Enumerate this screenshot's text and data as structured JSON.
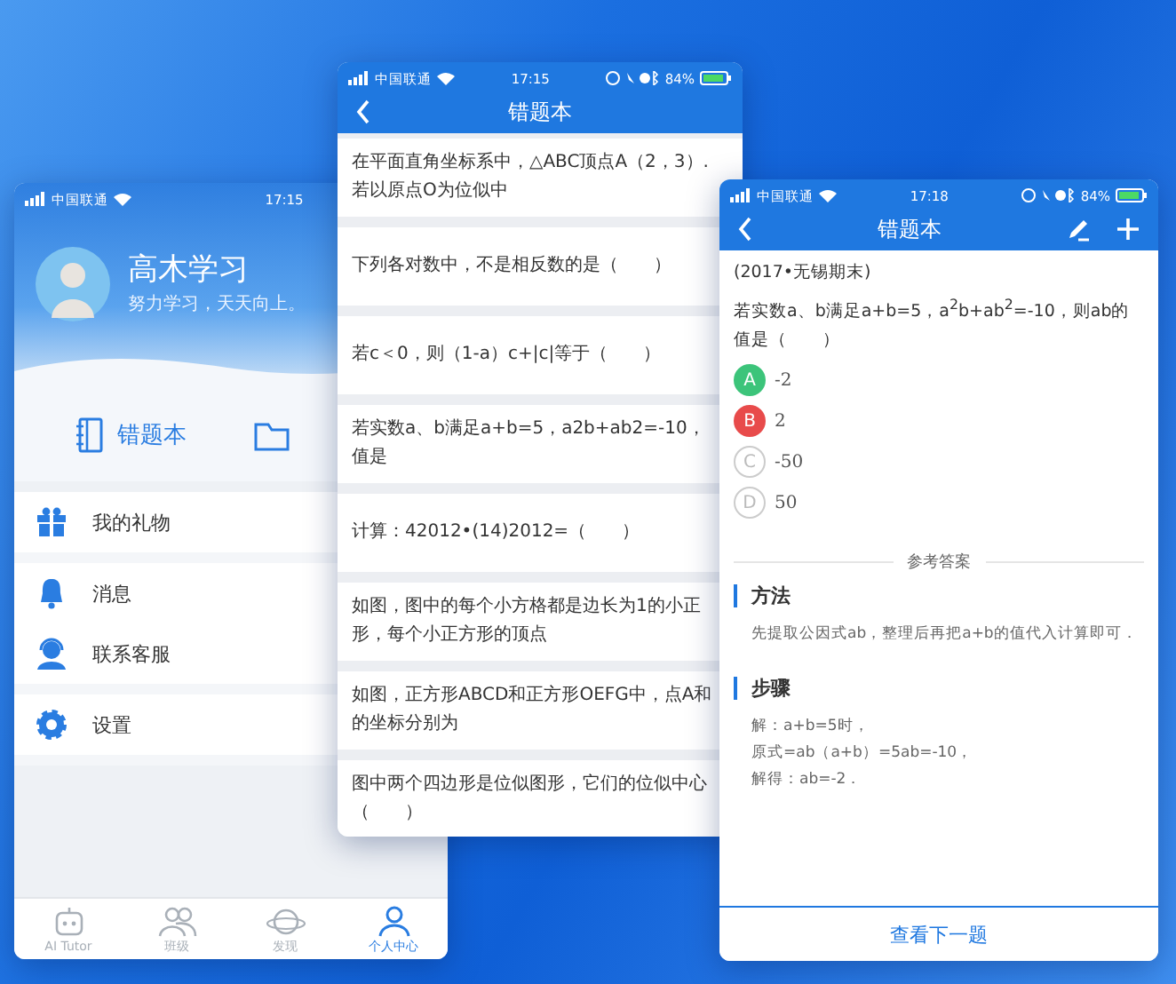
{
  "profile_screen": {
    "status_bar": {
      "carrier": "中国联通",
      "time": "17:15"
    },
    "name": "高木学习",
    "motto": "努力学习，天天向上。",
    "shortcuts": [
      {
        "label": "错题本"
      }
    ],
    "menu_groups": [
      [
        {
          "kind": "gift",
          "label": "我的礼物"
        }
      ],
      [
        {
          "kind": "bell",
          "label": "消息"
        },
        {
          "kind": "service",
          "label": "联系客服"
        }
      ],
      [
        {
          "kind": "gear",
          "label": "设置"
        }
      ]
    ],
    "tab_bar": [
      {
        "kind": "robot",
        "label": "AI Tutor",
        "selected": false
      },
      {
        "kind": "people",
        "label": "班级",
        "selected": false
      },
      {
        "kind": "planet",
        "label": "发现",
        "selected": false
      },
      {
        "kind": "person",
        "label": "个人中心",
        "selected": true
      }
    ]
  },
  "list_screen": {
    "status_bar": {
      "carrier": "中国联通",
      "time": "17:15",
      "battery": "84%"
    },
    "title": "错题本",
    "rows": [
      {
        "lines": [
          "在平面直角坐标系中，△ABC顶点A（2，3）.",
          "若以原点O为位似中"
        ]
      },
      {
        "lines": [
          "下列各对数中，不是相反数的是（　　）"
        ]
      },
      {
        "lines": [
          "若c＜0，则（1-a）c+|c|等于（　　）"
        ]
      },
      {
        "lines": [
          "若实数a、b满足a+b=5，a2b+ab2=-10，",
          "值是"
        ]
      },
      {
        "lines": [
          "计算：42012•(14)2012=（　　）"
        ]
      },
      {
        "lines": [
          "如图，图中的每个小方格都是边长为1的小正",
          "形，每个小正方形的顶点"
        ]
      },
      {
        "lines": [
          "如图，正方形ABCD和正方形OEFG中，点A和",
          "的坐标分别为"
        ]
      },
      {
        "lines": [
          "图中两个四边形是位似图形，它们的位似中心",
          "（　　）"
        ]
      }
    ]
  },
  "detail_screen": {
    "status_bar": {
      "carrier": "中国联通",
      "time": "17:18",
      "battery": "84%"
    },
    "title": "错题本",
    "source": "(2017•无锡期末)",
    "question": "若实数a、b满足a+b=5，a$^{2}$b+ab$^{2}$=-10，则ab的值是（　　）",
    "options": [
      {
        "letter": "A",
        "value": "-2",
        "is_answer": true,
        "picked": false
      },
      {
        "letter": "B",
        "value": "2",
        "is_answer": false,
        "picked": true
      },
      {
        "letter": "C",
        "value": "-50",
        "is_answer": false,
        "picked": false
      },
      {
        "letter": "D",
        "value": "50",
        "is_answer": false,
        "picked": false
      }
    ],
    "answer_heading": "参考答案",
    "sections": [
      {
        "heading": "方法",
        "lines": [
          "先提取公因式ab，整理后再把a+b的值代入计算即可．"
        ]
      },
      {
        "heading": "步骤",
        "lines": [
          "解：a+b=5时，",
          "原式=ab（a+b）=5ab=-10，",
          "解得：ab=-2．"
        ]
      }
    ],
    "next_button": "查看下一题"
  }
}
